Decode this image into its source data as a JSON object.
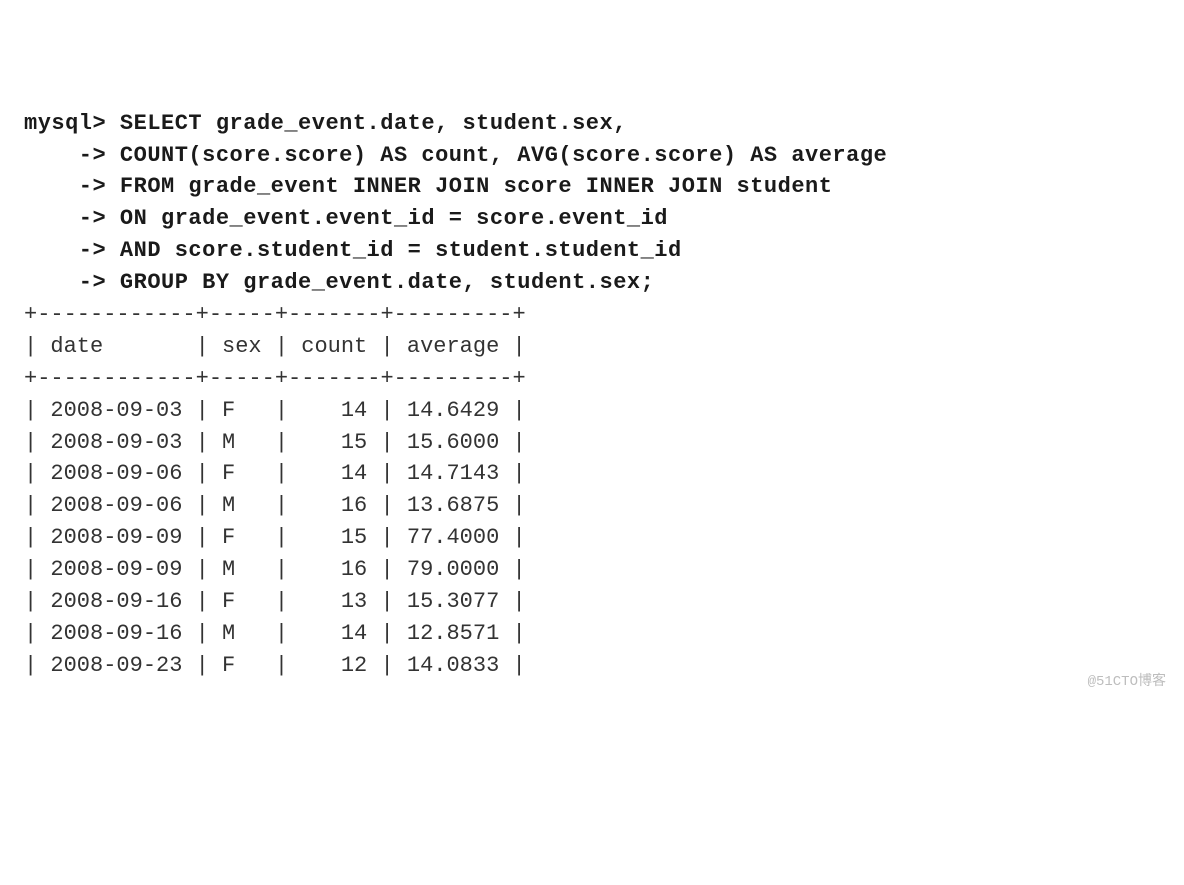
{
  "prompt": "mysql>",
  "cont": "    ->",
  "query_lines": [
    "SELECT grade_event.date, student.sex,",
    "COUNT(score.score) AS count, AVG(score.score) AS average",
    "FROM grade_event INNER JOIN score INNER JOIN student",
    "ON grade_event.event_id = score.event_id",
    "AND score.student_id = student.student_id",
    "GROUP BY grade_event.date, student.sex;"
  ],
  "table": {
    "border": "+------------+-----+-------+---------+",
    "header": "| date       | sex | count | average |",
    "rows": [
      "| 2008-09-03 | F   |    14 | 14.6429 |",
      "| 2008-09-03 | M   |    15 | 15.6000 |",
      "| 2008-09-06 | F   |    14 | 14.7143 |",
      "| 2008-09-06 | M   |    16 | 13.6875 |",
      "| 2008-09-09 | F   |    15 | 77.4000 |",
      "| 2008-09-09 | M   |    16 | 79.0000 |",
      "| 2008-09-16 | F   |    13 | 15.3077 |",
      "| 2008-09-16 | M   |    14 | 12.8571 |",
      "| 2008-09-23 | F   |    12 | 14.0833 |"
    ]
  },
  "chart_data": {
    "type": "table",
    "columns": [
      "date",
      "sex",
      "count",
      "average"
    ],
    "rows": [
      [
        "2008-09-03",
        "F",
        14,
        14.6429
      ],
      [
        "2008-09-03",
        "M",
        15,
        15.6
      ],
      [
        "2008-09-06",
        "F",
        14,
        14.7143
      ],
      [
        "2008-09-06",
        "M",
        16,
        13.6875
      ],
      [
        "2008-09-09",
        "F",
        15,
        77.4
      ],
      [
        "2008-09-09",
        "M",
        16,
        79.0
      ],
      [
        "2008-09-16",
        "F",
        13,
        15.3077
      ],
      [
        "2008-09-16",
        "M",
        14,
        12.8571
      ],
      [
        "2008-09-23",
        "F",
        12,
        14.0833
      ]
    ]
  },
  "watermark": "@51CTO博客"
}
